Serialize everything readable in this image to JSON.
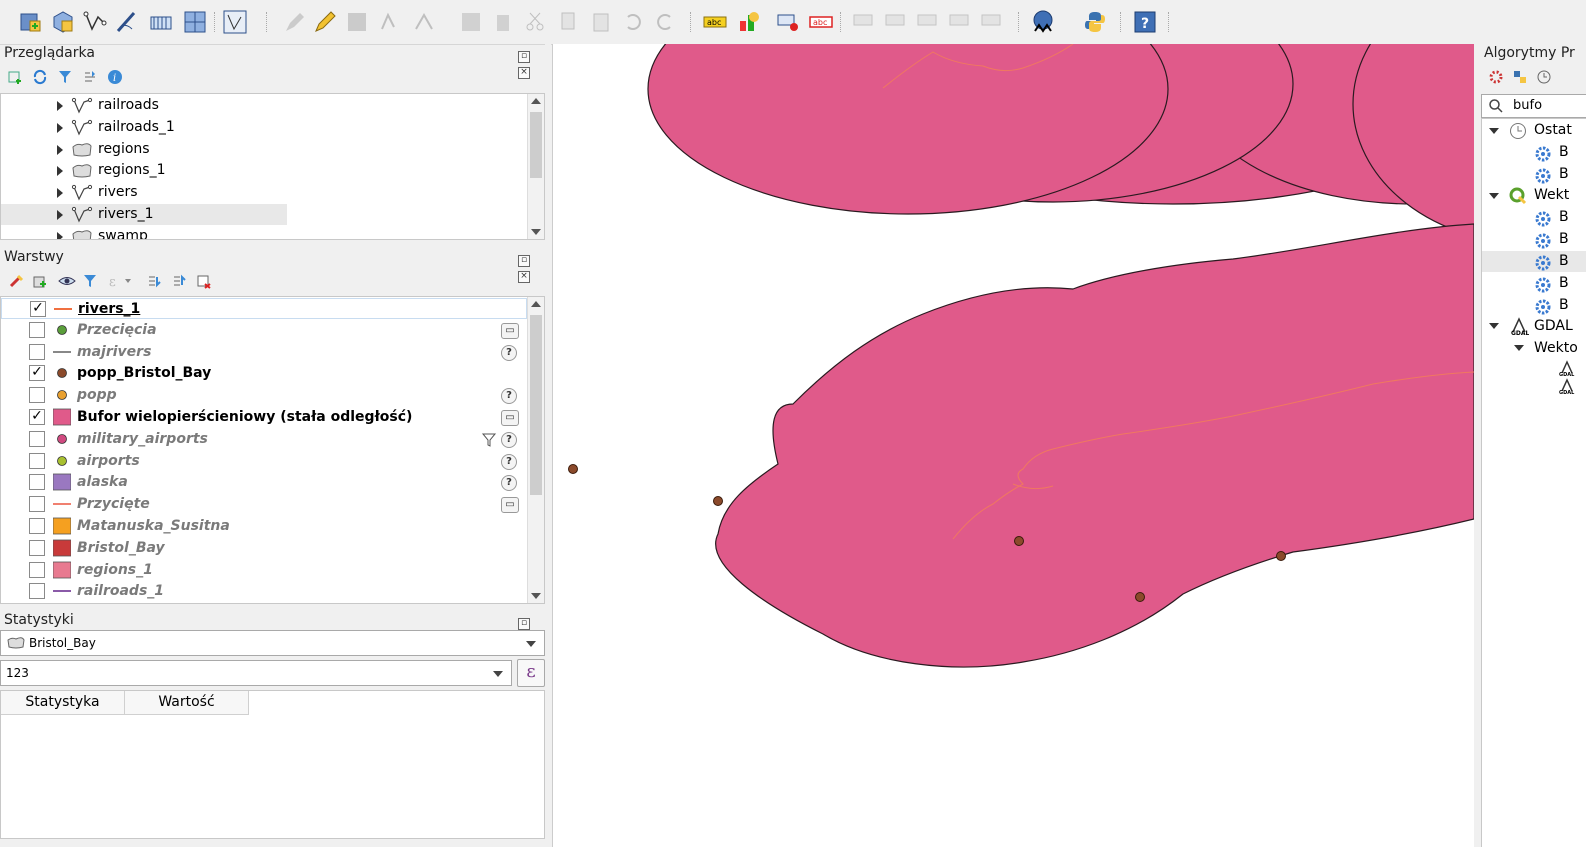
{
  "colors": {
    "accent": "#e05a8a",
    "buffer_fill": "#e05a8a",
    "river": "#f07860",
    "point": "#8b4a2b",
    "selected_row": "#e8e8e8"
  },
  "toolbar": {
    "icons": [
      "new-layer-icon",
      "add-raster-icon",
      "add-vector-icon",
      "digitize-icon",
      "add-wms-icon",
      "add-grid-icon",
      "vertex-tool-icon",
      "edit-pencil-icon",
      "save-edits-icon",
      "add-feature-icon",
      "move-feature-icon",
      "attribute-table-icon",
      "delete-icon",
      "cut-icon",
      "copy-icon",
      "paste-icon",
      "undo-icon",
      "redo-icon",
      "label-icon",
      "diagram-icon",
      "pin-label-icon",
      "label-red-icon",
      "help-icon",
      "python-icon",
      "globe-plugin-icon"
    ]
  },
  "browser": {
    "title": "Przeglądarka",
    "items": [
      {
        "label": "railroads",
        "type": "line"
      },
      {
        "label": "railroads_1",
        "type": "line"
      },
      {
        "label": "regions",
        "type": "polygon"
      },
      {
        "label": "regions_1",
        "type": "polygon"
      },
      {
        "label": "rivers",
        "type": "line"
      },
      {
        "label": "rivers_1",
        "type": "line"
      },
      {
        "label": "swamp",
        "type": "polygon"
      }
    ]
  },
  "layers": {
    "title": "Warstwy",
    "items": [
      {
        "label": "rivers_1",
        "checked": true,
        "symbol": "line-orange"
      },
      {
        "label": "Przecięcia",
        "checked": false,
        "symbol": "point-green",
        "badge": "memory"
      },
      {
        "label": "majrivers",
        "checked": false,
        "symbol": "line-gray",
        "badge": "?"
      },
      {
        "label": "popp_Bristol_Bay",
        "checked": true,
        "symbol": "point-brown"
      },
      {
        "label": "popp",
        "checked": false,
        "symbol": "point-orange",
        "badge": "?"
      },
      {
        "label": "Bufor wielopierścieniowy (stała odległość)",
        "checked": true,
        "symbol": "fill-pink",
        "badge": "memory"
      },
      {
        "label": "military_airports",
        "checked": false,
        "symbol": "point-pink",
        "badge": "?"
      },
      {
        "label": "airports",
        "checked": false,
        "symbol": "point-lime",
        "badge": "?"
      },
      {
        "label": "alaska",
        "checked": false,
        "symbol": "fill-purple",
        "badge": "?"
      },
      {
        "label": "Przycięte",
        "checked": false,
        "symbol": "line-salmon",
        "badge": "memory"
      },
      {
        "label": "Matanuska_Susitna",
        "checked": false,
        "symbol": "fill-orange"
      },
      {
        "label": "Bristol_Bay",
        "checked": false,
        "symbol": "fill-red"
      },
      {
        "label": "regions_1",
        "checked": false,
        "symbol": "fill-lightpink"
      },
      {
        "label": "railroads_1",
        "checked": false,
        "symbol": "line-purple"
      }
    ]
  },
  "stats": {
    "title": "Statystyki",
    "layer_select": "Bristol_Bay",
    "field_select": "123",
    "col_stat": "Statystyka",
    "col_value": "Wartość",
    "epsilon": "ε"
  },
  "processing": {
    "title": "Algorytmy Pr",
    "search_value": "bufo",
    "groups": [
      {
        "label": "Ostat"
      },
      {
        "label": "Wekt"
      },
      {
        "label": "GDAL"
      },
      {
        "label": "Wekto"
      }
    ],
    "algo_letter": "B"
  }
}
